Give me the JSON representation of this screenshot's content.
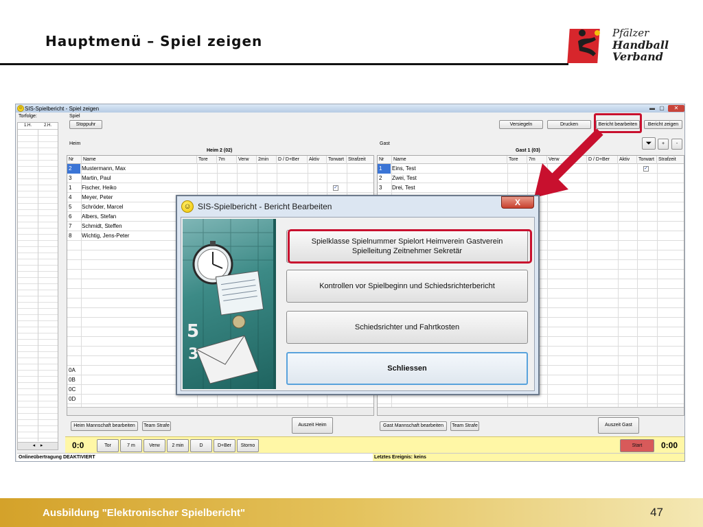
{
  "slide": {
    "title": "Hauptmenü – Spiel zeigen",
    "footer": "Ausbildung \"Elektronischer Spielbericht\"",
    "page_number": "47",
    "logo": {
      "line1": "Pfälzer",
      "line2": "Handball",
      "line3": "Verband"
    }
  },
  "app": {
    "window_title": "SIS-Spielbericht - Spiel zeigen",
    "torfolge_label": "Torfolge:",
    "torfolge_cols": [
      "1.H.",
      "2.H."
    ],
    "spiel_label": "Spiel",
    "stoppuhr": "Stoppuhr",
    "toolbar": {
      "versiegeln": "Versiegeln",
      "drucken": "Drucken",
      "bericht_bearbeiten": "Bericht bearbeiten",
      "bericht_zeigen": "Bericht zeigen"
    },
    "heim": {
      "label": "Heim",
      "team": "Heim 2 (02)"
    },
    "gast": {
      "label": "Gast",
      "team": "Gast 1 (03)"
    },
    "columns": [
      "Nr",
      "Name",
      "Tore",
      "7m",
      "Verw",
      "2min",
      "D / D+Ber",
      "Aktiv",
      "Torwart",
      "Strafzeit"
    ],
    "heim_players": [
      {
        "nr": "2",
        "name": "Mustermann, Max"
      },
      {
        "nr": "3",
        "name": "Martin, Paul"
      },
      {
        "nr": "1",
        "name": "Fischer, Heiko"
      },
      {
        "nr": "4",
        "name": "Meyer, Peter"
      },
      {
        "nr": "5",
        "name": "Schröder, Marcel"
      },
      {
        "nr": "6",
        "name": "Albers, Stefan"
      },
      {
        "nr": "7",
        "name": "Schmidt, Steffen"
      },
      {
        "nr": "8",
        "name": "Wichtig, Jens-Peter"
      }
    ],
    "heim_officials": [
      "0A",
      "0B",
      "0C",
      "0D"
    ],
    "gast_players": [
      {
        "nr": "1",
        "name": "Eins, Test"
      },
      {
        "nr": "2",
        "name": "Zwei, Test"
      },
      {
        "nr": "3",
        "name": "Drei, Test"
      }
    ],
    "bottom": {
      "heim_mannschaft": "Heim Mannschaft bearbeiten",
      "team_strafe": "Team Strafe",
      "auszeit_heim": "Auszeit Heim",
      "gast_mannschaft": "Gast Mannschaft bearbeiten",
      "auszeit_gast": "Auszeit Gast"
    },
    "action_bar": {
      "score_left": "0:0",
      "buttons": [
        "Tor",
        "7 m",
        "Verw",
        "2 min",
        "D",
        "D+Ber",
        "Storno"
      ],
      "start": "Start",
      "score_right": "0:00"
    },
    "status_left": "Onlineübertragung DEAKTIVIERT",
    "status_right": "Letztes Ereignis: keins"
  },
  "dialog": {
    "title": "SIS-Spielbericht - Bericht Bearbeiten",
    "close_label": "X",
    "btn1_line1": "Spielklasse Spielnummer Spielort Heimverein Gastverein",
    "btn1_line2": "Spielleitung Zeitnehmer Sekretär",
    "btn2": "Kontrollen vor Spielbeginn und Schiedsrichterbericht",
    "btn3": "Schiedsrichter und Fahrtkosten",
    "btn4": "Schliessen"
  },
  "colors": {
    "highlight": "#c8102e",
    "accent_blue": "#3b75d6",
    "footer_gold": "#d4a22a"
  }
}
